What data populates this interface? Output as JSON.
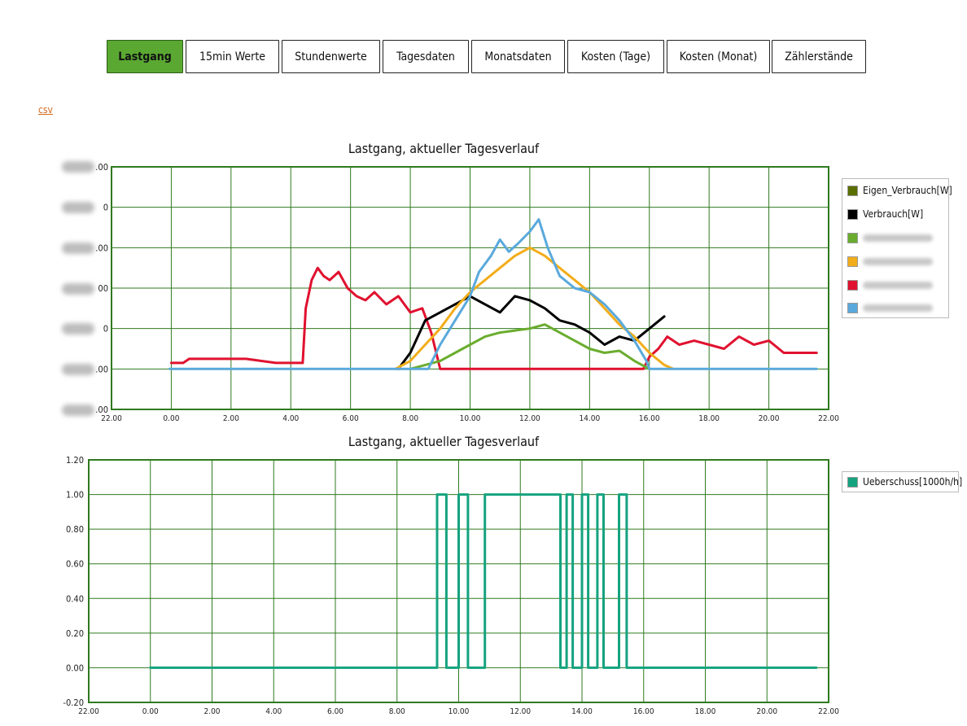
{
  "tabs": [
    {
      "label": "Lastgang",
      "active": true
    },
    {
      "label": "15min Werte",
      "active": false
    },
    {
      "label": "Stundenwerte",
      "active": false
    },
    {
      "label": "Tagesdaten",
      "active": false
    },
    {
      "label": "Monatsdaten",
      "active": false
    },
    {
      "label": "Kosten (Tage)",
      "active": false
    },
    {
      "label": "Kosten (Monat)",
      "active": false
    },
    {
      "label": "Zählerstände",
      "active": false
    }
  ],
  "csv_link": "csv",
  "colors": {
    "accent": "#5aa832",
    "grid": "#2f7a1f",
    "eigen": "#5b6e00",
    "verbrauch": "#000000",
    "green": "#6aad2e",
    "orange": "#f2ad1a",
    "red": "#e0112f",
    "blue": "#5aa9dc",
    "ueberschuss": "#14a37f"
  },
  "chart_data": [
    {
      "type": "line",
      "title": "Lastgang, aktueller Tagesverlauf",
      "x_ticks": [
        "22.00",
        "0.00",
        "2.00",
        "4.00",
        "6.00",
        "8.00",
        "10.00",
        "12.00",
        "14.00",
        "16.00",
        "18.00",
        "20.00",
        "22.00"
      ],
      "y_ticks": [
        ".00",
        "0",
        ".00",
        "00",
        "0",
        ".00",
        ".00"
      ],
      "y_ticks_redacted": true,
      "xlim": [
        -2,
        22
      ],
      "ylim": [
        -1,
        5
      ],
      "grid": true,
      "legend_position": "right",
      "legend": [
        {
          "name": "Eigen_Verbrauch[W]",
          "color": "#5b6e00",
          "redacted": false
        },
        {
          "name": "Verbrauch[W]",
          "color": "#000000",
          "redacted": false
        },
        {
          "name": "",
          "color": "#6aad2e",
          "redacted": true
        },
        {
          "name": "",
          "color": "#f2ad1a",
          "redacted": true
        },
        {
          "name": "",
          "color": "#e0112f",
          "redacted": true
        },
        {
          "name": "",
          "color": "#5aa9dc",
          "redacted": true
        }
      ],
      "series": [
        {
          "key": "red",
          "color": "#e0112f",
          "x": [
            0.0,
            0.4,
            0.6,
            1.0,
            1.5,
            2.0,
            2.5,
            3.0,
            3.5,
            4.4,
            4.5,
            4.7,
            4.9,
            5.1,
            5.3,
            5.6,
            5.9,
            6.2,
            6.5,
            6.8,
            7.2,
            7.6,
            8.0,
            8.4,
            8.7,
            9.0,
            9.5,
            10.0,
            11.0,
            12.0,
            13.0,
            14.0,
            15.0,
            15.8,
            16.0,
            16.3,
            16.6,
            17.0,
            17.5,
            18.0,
            18.5,
            19.0,
            19.5,
            20.0,
            20.5,
            21.0,
            21.6
          ],
          "y": [
            0.15,
            0.15,
            0.25,
            0.25,
            0.25,
            0.25,
            0.25,
            0.2,
            0.15,
            0.15,
            1.5,
            2.2,
            2.5,
            2.3,
            2.2,
            2.4,
            2.0,
            1.8,
            1.7,
            1.9,
            1.6,
            1.8,
            1.4,
            1.5,
            0.9,
            0.0,
            0.0,
            0.0,
            0.0,
            0.0,
            0.0,
            0.0,
            0.0,
            0.0,
            0.3,
            0.5,
            0.8,
            0.6,
            0.7,
            0.6,
            0.5,
            0.8,
            0.6,
            0.7,
            0.4,
            0.4,
            0.4
          ]
        },
        {
          "key": "black",
          "color": "#000000",
          "x": [
            7.6,
            8.0,
            8.5,
            9.0,
            9.5,
            10.0,
            10.5,
            11.0,
            11.5,
            12.0,
            12.5,
            13.0,
            13.5,
            14.0,
            14.5,
            15.0,
            15.5,
            16.0,
            16.5
          ],
          "y": [
            0.0,
            0.4,
            1.2,
            1.4,
            1.6,
            1.8,
            1.6,
            1.4,
            1.8,
            1.7,
            1.5,
            1.2,
            1.1,
            0.9,
            0.6,
            0.8,
            0.7,
            1.0,
            1.3
          ]
        },
        {
          "key": "orange",
          "color": "#f2ad1a",
          "x": [
            7.5,
            8.0,
            8.5,
            9.0,
            9.5,
            10.0,
            10.5,
            11.0,
            11.5,
            12.0,
            12.5,
            13.0,
            13.5,
            14.0,
            14.5,
            15.0,
            15.5,
            16.0,
            16.5,
            16.8
          ],
          "y": [
            0.0,
            0.2,
            0.6,
            1.0,
            1.5,
            1.9,
            2.2,
            2.5,
            2.8,
            3.0,
            2.8,
            2.5,
            2.2,
            1.9,
            1.5,
            1.1,
            0.8,
            0.4,
            0.1,
            0.0
          ]
        },
        {
          "key": "green",
          "color": "#6aad2e",
          "x": [
            8.0,
            8.5,
            9.0,
            9.5,
            10.0,
            10.5,
            11.0,
            11.5,
            12.0,
            12.5,
            13.0,
            13.5,
            14.0,
            14.5,
            15.0,
            15.5,
            16.0
          ],
          "y": [
            0.0,
            0.1,
            0.2,
            0.4,
            0.6,
            0.8,
            0.9,
            0.95,
            1.0,
            1.1,
            0.9,
            0.7,
            0.5,
            0.4,
            0.45,
            0.2,
            0.0
          ]
        },
        {
          "key": "blue",
          "color": "#5aa9dc",
          "x": [
            -0.05,
            8.6,
            9.0,
            9.5,
            10.0,
            10.3,
            10.7,
            11.0,
            11.3,
            11.6,
            12.0,
            12.3,
            12.6,
            13.0,
            13.5,
            14.0,
            14.5,
            15.0,
            15.5,
            15.9,
            16.0,
            21.6
          ],
          "y": [
            0.0,
            0.0,
            0.6,
            1.2,
            1.8,
            2.4,
            2.8,
            3.2,
            2.9,
            3.1,
            3.4,
            3.7,
            3.0,
            2.3,
            2.0,
            1.9,
            1.6,
            1.2,
            0.7,
            0.2,
            0.0,
            0.0
          ]
        }
      ]
    },
    {
      "type": "line",
      "title": "Lastgang, aktueller Tagesverlauf",
      "x_ticks": [
        "22.00",
        "0.00",
        "2.00",
        "4.00",
        "6.00",
        "8.00",
        "10.00",
        "12.00",
        "14.00",
        "16.00",
        "18.00",
        "20.00",
        "22.00"
      ],
      "y_ticks": [
        "1.20",
        "1.00",
        "0.80",
        "0.60",
        "0.40",
        "0.20",
        "0.00",
        "-0.20"
      ],
      "xlim": [
        -2,
        22
      ],
      "ylim": [
        -0.2,
        1.2
      ],
      "grid": true,
      "legend_position": "right",
      "legend": [
        {
          "name": "Ueberschuss[1000h/h]",
          "color": "#14a37f",
          "redacted": false
        }
      ],
      "series": [
        {
          "name": "Ueberschuss[1000h/h]",
          "color": "#14a37f",
          "x": [
            0,
            9.3,
            9.3,
            9.6,
            9.6,
            10.0,
            10.0,
            10.3,
            10.3,
            10.85,
            10.85,
            13.3,
            13.3,
            13.5,
            13.5,
            13.7,
            13.7,
            14.0,
            14.0,
            14.2,
            14.2,
            14.5,
            14.5,
            14.7,
            14.7,
            15.2,
            15.2,
            15.45,
            15.45,
            21.6
          ],
          "y": [
            0,
            0,
            1,
            1,
            0,
            0,
            1,
            1,
            0,
            0,
            1,
            1,
            0,
            0,
            1,
            1,
            0,
            0,
            1,
            1,
            0,
            0,
            1,
            1,
            0,
            0,
            1,
            1,
            0,
            0
          ]
        }
      ]
    }
  ]
}
